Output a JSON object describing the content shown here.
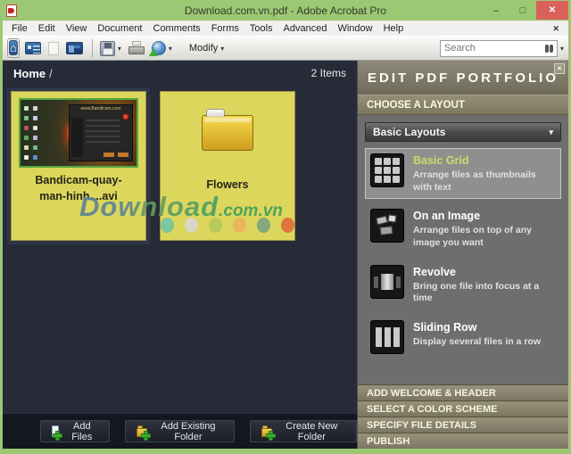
{
  "window": {
    "title": "Download.com.vn.pdf - Adobe Acrobat Pro"
  },
  "icons": {
    "home": "⌂",
    "caret": "▾",
    "close": "✕",
    "minimize": "–",
    "maximize": "□",
    "app_icon": "acrobat-pdf-icon",
    "search": "binoculars-icon"
  },
  "menu": {
    "items": [
      "File",
      "Edit",
      "View",
      "Document",
      "Comments",
      "Forms",
      "Tools",
      "Advanced",
      "Window",
      "Help"
    ]
  },
  "toolbar": {
    "modify_label": "Modify",
    "search_placeholder": "Search"
  },
  "breadcrumb": {
    "home": "Home",
    "separator": "/",
    "items_count": "2 Items"
  },
  "cards": [
    {
      "title": "Bandicam-quay-man-hinh....avi",
      "type": "video-thumbnail",
      "thumbnail_caption": "www.Bandicam.com"
    },
    {
      "title": "Flowers",
      "type": "folder"
    }
  ],
  "watermark": {
    "part1": "Download",
    "part2": ".com.vn",
    "dot_colors": [
      "#7cc79c",
      "#d9d6c6",
      "#b8c95e",
      "#eab55e",
      "#83aa7c",
      "#e0763c"
    ]
  },
  "panel": {
    "title": "EDIT PDF PORTFOLIO",
    "section": "CHOOSE A LAYOUT",
    "dropdown_value": "Basic Layouts",
    "layouts": [
      {
        "name": "Basic Grid",
        "desc": "Arrange files as thumbnails with text",
        "selected": true
      },
      {
        "name": "On an Image",
        "desc": "Arrange files on top of any image you want",
        "selected": false
      },
      {
        "name": "Revolve",
        "desc": "Bring one file into focus at a time",
        "selected": false
      },
      {
        "name": "Sliding Row",
        "desc": "Display several files in a row",
        "selected": false
      }
    ],
    "accordions": [
      "ADD WELCOME & HEADER",
      "SELECT A COLOR SCHEME",
      "SPECIFY FILE DETAILS",
      "PUBLISH"
    ]
  },
  "footer": {
    "buttons": [
      "Add Files",
      "Add Existing Folder",
      "Create New Folder"
    ]
  },
  "colors": {
    "titlebar_green": "#9cc873",
    "close_button_red": "#d9635a",
    "card_yellow": "#dcd65c",
    "selected_layout_name": "#ccdb6b",
    "main_background": "#262b37",
    "panel_olive": "#7c7760"
  }
}
